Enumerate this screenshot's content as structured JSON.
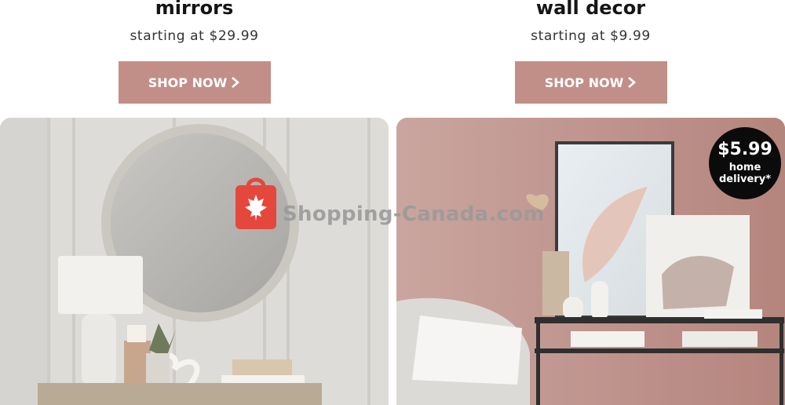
{
  "left": {
    "title": "mirrors",
    "price": "starting at $29.99",
    "button": "SHOP NOW"
  },
  "right": {
    "title": "wall decor",
    "price": "starting at $9.99",
    "button": "SHOP NOW",
    "badge": {
      "amount": "$5.99",
      "line1": "home",
      "line2": "delivery*"
    }
  },
  "watermark": {
    "text": "Shopping-Canada.com"
  },
  "colors": {
    "button": "#c28f88",
    "badge": "#0b0b0b",
    "watermark_bag": "#e5473c"
  }
}
